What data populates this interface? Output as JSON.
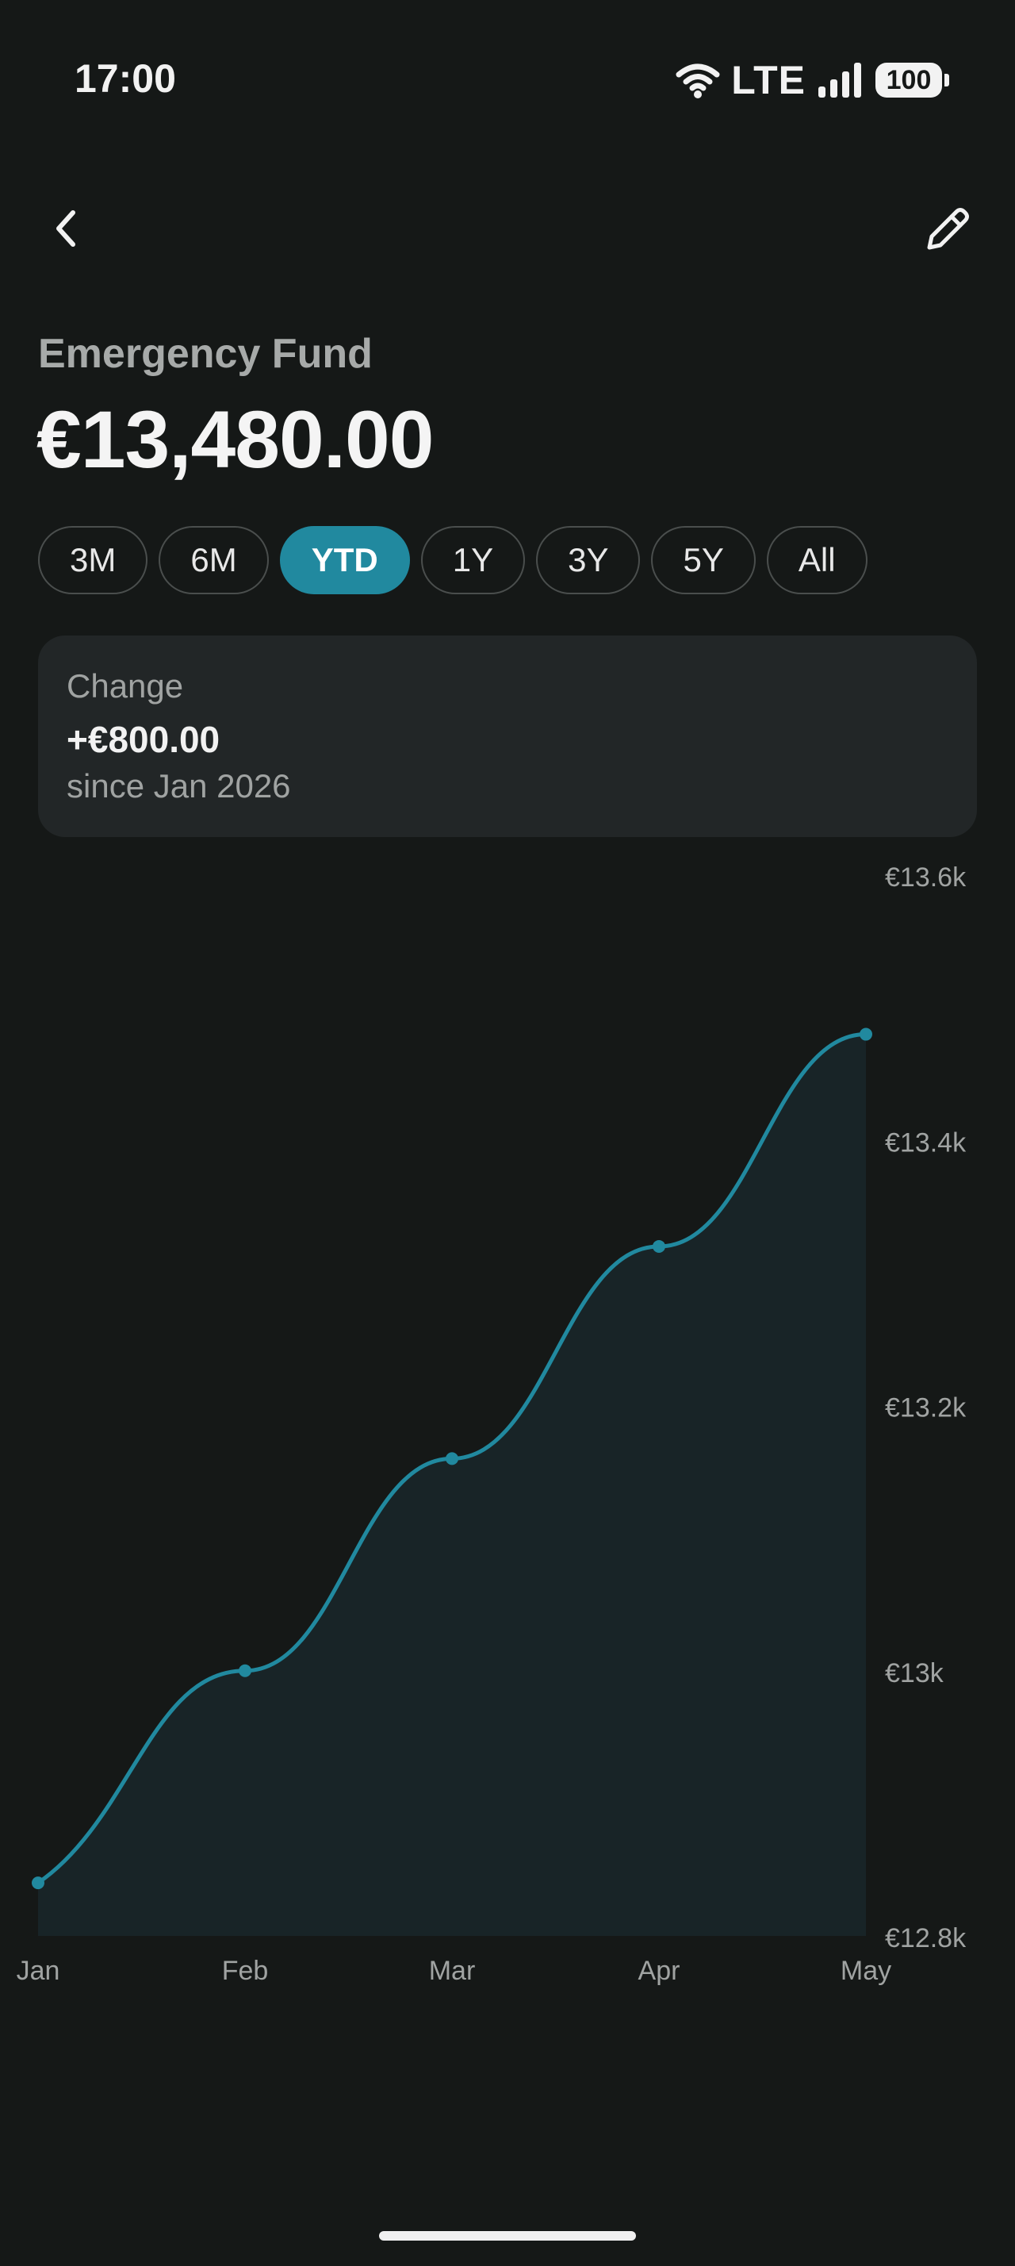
{
  "status_bar": {
    "time": "17:00",
    "network": "LTE",
    "battery": "100"
  },
  "header": {
    "back_icon": "chevron-left-icon",
    "edit_icon": "pencil-icon"
  },
  "account": {
    "name": "Emergency Fund",
    "balance": "€13,480.00"
  },
  "ranges": [
    {
      "label": "3M",
      "active": false
    },
    {
      "label": "6M",
      "active": false
    },
    {
      "label": "YTD",
      "active": true
    },
    {
      "label": "1Y",
      "active": false
    },
    {
      "label": "3Y",
      "active": false
    },
    {
      "label": "5Y",
      "active": false
    },
    {
      "label": "All",
      "active": false
    }
  ],
  "change": {
    "label": "Change",
    "value": "+€800.00",
    "since": "since Jan 2026"
  },
  "colors": {
    "accent": "#21899f",
    "background": "#151817",
    "card": "#222627",
    "area_fill": "#182427"
  },
  "chart_data": {
    "type": "area",
    "x": [
      "Jan",
      "Feb",
      "Mar",
      "Apr",
      "May"
    ],
    "values": [
      12840,
      13000,
      13160,
      13320,
      13480
    ],
    "ylim": [
      12800,
      13600
    ],
    "y_ticks": [
      {
        "value": 13600,
        "label": "€13.6k"
      },
      {
        "value": 13400,
        "label": "€13.4k"
      },
      {
        "value": 13200,
        "label": "€13.2k"
      },
      {
        "value": 13000,
        "label": "€13k"
      },
      {
        "value": 12800,
        "label": "€12.8k"
      }
    ],
    "y_axis_position": "right",
    "grid": false,
    "legend": "none"
  }
}
